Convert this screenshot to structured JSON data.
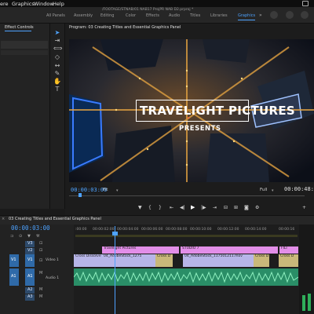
{
  "menu": {
    "items": [
      "ere",
      "Graphics",
      "Window",
      "Help"
    ]
  },
  "title_bar": {
    "path": "/FOOTAGE/STNAB/01 NAB17 ProjPR NAB D2.prproj *"
  },
  "workspaces": [
    "All Panels",
    "Assembly",
    "Editing",
    "Color",
    "Effects",
    "Audio",
    "Titles",
    "Libraries",
    "Graphics"
  ],
  "active_workspace": "Graphics",
  "left_panel": {
    "tab": "Effect Controls"
  },
  "program_monitor": {
    "tab": "Program: 03 Creating Titles and Essential Graphics Panel",
    "overlay_title": "TRAVELIGHT PICTURES",
    "overlay_subtitle": "PRESENTS",
    "current_time": "00:00:03:00",
    "fit": "Fit",
    "quality": "Full",
    "duration": "00:00:48:04"
  },
  "timeline": {
    "tab": "03 Creating Titles and Essential Graphics Panel",
    "timecode": "00:00:03:00",
    "ruler": [
      ":00:00",
      "00:00:02:00",
      "00:00:04:00",
      "00:00:06:00",
      "00:00:08:00",
      "00:00:10:00",
      "00:00:12:00",
      "00:00:14:00",
      "00:00:16"
    ],
    "tracks": {
      "v3": "V3",
      "v2": "V2",
      "v1_src": "V1",
      "v1": "V1",
      "video1": "Video 1",
      "a1_src": "A1",
      "a1": "A1",
      "audio1": "Audio 1",
      "a2": "A2",
      "a3": "A3"
    },
    "clips": {
      "v2_title": "Travelight Pictures",
      "v2_studio": "STUDIO 7",
      "v2_end": "FILI",
      "v1_cross_dissolve_a": "Cross Dissolve",
      "v1_clip_a": "04_AdobeStock_1275",
      "v1_cross_dissolve_b": "Cross D",
      "v1_clip_b": "04_AdobeStock_117501211.mov",
      "v1_cross_dissolve_c": "Cross D",
      "v1_cross_dissolve_d": "Cross D"
    }
  }
}
